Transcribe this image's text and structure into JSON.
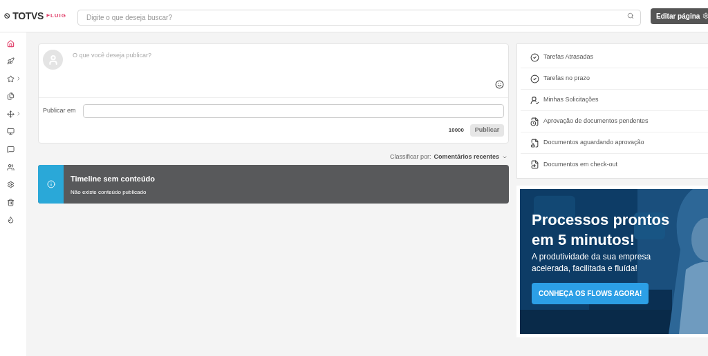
{
  "header": {
    "logo": "TOTVS",
    "logo_sub": "FLUIG",
    "search": {
      "placeholder": "Digite o que deseja buscar?"
    },
    "edit_button": "Editar página"
  },
  "sidebar": {
    "items": [
      {
        "selected": true,
        "submenu": false
      },
      {
        "selected": false,
        "submenu": false
      },
      {
        "selected": false,
        "submenu": true
      },
      {
        "selected": false,
        "submenu": false
      },
      {
        "selected": false,
        "submenu": true
      },
      {
        "selected": false,
        "submenu": false
      },
      {
        "selected": false,
        "submenu": false
      },
      {
        "selected": false,
        "submenu": false
      },
      {
        "selected": false,
        "submenu": false
      },
      {
        "selected": false,
        "submenu": false
      },
      {
        "selected": false,
        "submenu": false
      }
    ]
  },
  "composer": {
    "placeholder": "O que você deseja publicar?",
    "publish_in_label": "Publicar em",
    "char_count": "10000",
    "publish_button": "Publicar",
    "publish_disabled": true
  },
  "sort": {
    "label": "Classificar por:",
    "value": "Comentários recentes"
  },
  "timeline_notice": {
    "title": "Timeline sem conteúdo",
    "message": "Não existe conteúdo publicado"
  },
  "tasks": [
    {
      "label": "Tarefas Atrasadas"
    },
    {
      "label": "Tarefas no prazo"
    },
    {
      "label": "Minhas Solicitações"
    },
    {
      "label": "Aprovação de documentos pendentes"
    },
    {
      "label": "Documentos aguardando aprovação"
    },
    {
      "label": "Documentos em check-out"
    }
  ],
  "banner": {
    "headline": "Processos prontos em 5 minutos!",
    "subtitle": "A produtividade da sua empresa acelerada, facilitada e fluída!",
    "cta": "CONHEÇA OS FLOWS AGORA!"
  }
}
